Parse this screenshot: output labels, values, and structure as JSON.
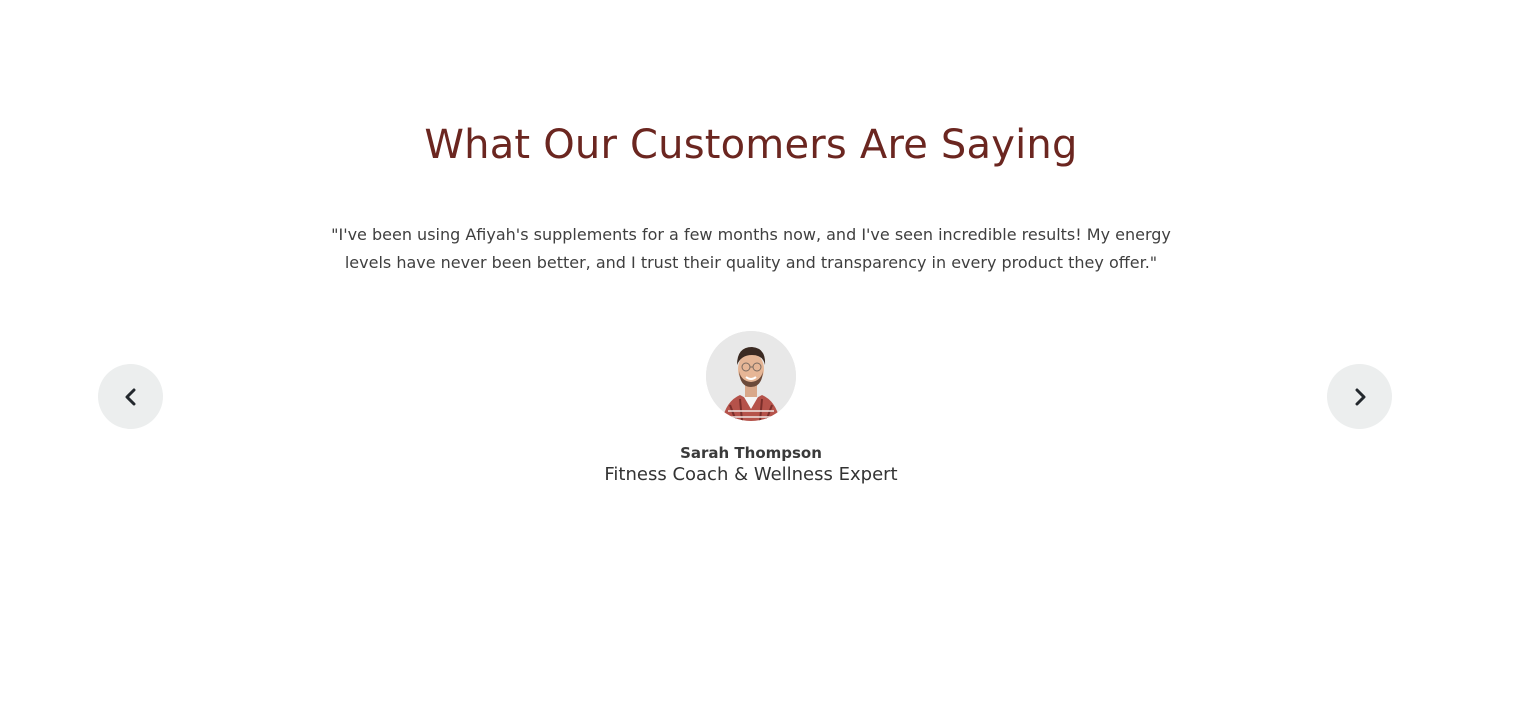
{
  "testimonials": {
    "heading": "What Our Customers Are Saying",
    "quote": "\"I've been using Afiyah's supplements for a few months now, and I've seen incredible results! My energy levels have never been better, and I trust their quality and transparency in every product they offer.\"",
    "author": {
      "name": "Sarah Thompson",
      "role": "Fitness Coach & Wellness Expert"
    },
    "navigation": {
      "prev_icon": "chevron-left-icon",
      "next_icon": "chevron-right-icon"
    }
  },
  "colors": {
    "heading": "#6b2620",
    "body_text": "#3f3f3f",
    "nav_button_bg": "#eceeee",
    "nav_icon": "#23282d"
  }
}
